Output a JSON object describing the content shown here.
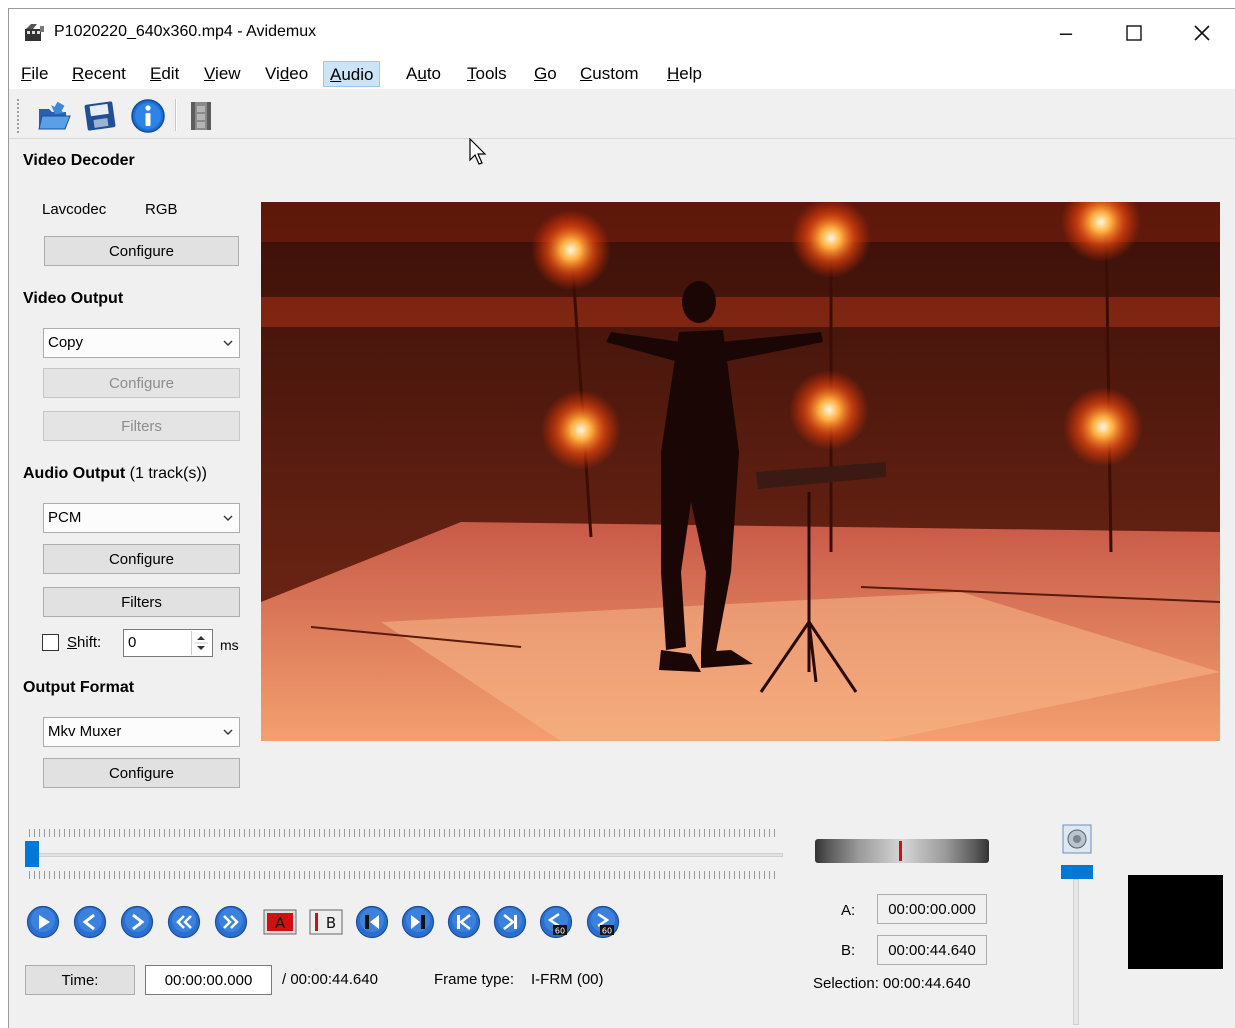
{
  "window": {
    "title": "P1020220_640x360.mp4 - Avidemux",
    "minimize": "–",
    "maximize": "☐",
    "close": "✕"
  },
  "menu": [
    {
      "label": "File",
      "mnemonic": "F",
      "rest": "ile"
    },
    {
      "label": "Recent",
      "mnemonic": "R",
      "rest": "ecent"
    },
    {
      "label": "Edit",
      "mnemonic": "E",
      "rest": "dit"
    },
    {
      "label": "View",
      "mnemonic": "V",
      "rest": "iew"
    },
    {
      "label": "Video",
      "pre": "Vi",
      "mnemonic": "d",
      "rest": "eo"
    },
    {
      "label": "Audio",
      "mnemonic": "A",
      "rest": "udio"
    },
    {
      "label": "Auto",
      "pre": "A",
      "mnemonic": "u",
      "rest": "to"
    },
    {
      "label": "Tools",
      "mnemonic": "T",
      "rest": "ools"
    },
    {
      "label": "Go",
      "mnemonic": "G",
      "rest": "o"
    },
    {
      "label": "Custom",
      "mnemonic": "C",
      "rest": "ustom"
    },
    {
      "label": "Help",
      "mnemonic": "H",
      "rest": "elp"
    }
  ],
  "toolbar": {
    "icons": [
      "open-file-icon",
      "save-icon",
      "info-icon",
      "calculator-film-icon"
    ]
  },
  "video_decoder": {
    "heading": "Video Decoder",
    "codec": "Lavcodec",
    "format": "RGB",
    "configure": "Configure"
  },
  "video_output": {
    "heading": "Video Output",
    "selected": "Copy",
    "configure": "Configure",
    "filters": "Filters"
  },
  "audio_output": {
    "heading": "Audio Output",
    "tracks": "(1 track(s))",
    "selected": "PCM",
    "configure": "Configure",
    "filters": "Filters",
    "shift_mnemonic": "S",
    "shift_rest": "hift:",
    "shift_value": "0",
    "shift_unit": "ms"
  },
  "output_format": {
    "heading": "Output Format",
    "selected": "Mkv Muxer",
    "configure": "Configure"
  },
  "playback": {
    "position_fraction": 0,
    "time_button": "Time:",
    "current_time": "00:00:00.000",
    "total_time": "/ 00:00:44.640",
    "frame_type_label": "Frame type:",
    "frame_type_value": "I-FRM (00)"
  },
  "controls": [
    "play-icon",
    "previous-frame-icon",
    "next-frame-icon",
    "previous-keyframe-icon",
    "next-keyframe-icon",
    "set-marker-a-icon",
    "set-marker-b-icon",
    "go-marker-a-icon",
    "go-marker-b-icon",
    "first-frame-icon",
    "last-frame-icon",
    "back-60s-icon",
    "forward-60s-icon"
  ],
  "selection": {
    "a_label": "A:",
    "a_value": "00:00:00.000",
    "b_label": "B:",
    "b_value": "00:00:44.640",
    "selection_label": "Selection: 00:00:44.640"
  },
  "volume": {
    "level_fraction": 1
  },
  "colors": {
    "accent": "#0078d7",
    "button_blue": "#2a6fd0",
    "marker_red": "#d01010"
  }
}
